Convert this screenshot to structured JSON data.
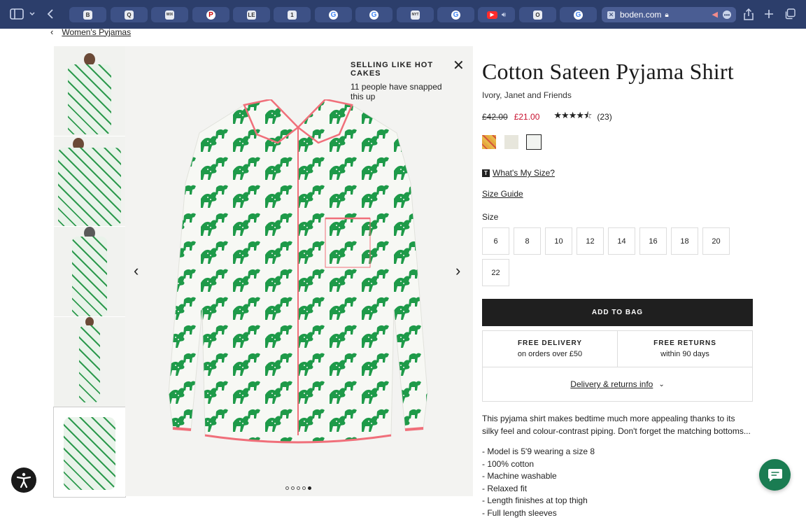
{
  "browser": {
    "tabs": [
      {
        "icon": "b-favicon",
        "glyph": "B"
      },
      {
        "icon": "q-favicon",
        "glyph": "Q"
      },
      {
        "icon": "wix-favicon",
        "glyph": "WIX"
      },
      {
        "icon": "pinterest-favicon",
        "glyph": "P"
      },
      {
        "icon": "le-favicon",
        "glyph": "LE"
      },
      {
        "icon": "one-favicon",
        "glyph": "1"
      },
      {
        "icon": "google-favicon",
        "glyph": "G"
      },
      {
        "icon": "google-favicon",
        "glyph": "G"
      },
      {
        "icon": "nyt-favicon",
        "glyph": "NYT"
      },
      {
        "icon": "google-favicon",
        "glyph": "G"
      },
      {
        "icon": "youtube-favicon",
        "glyph": "▶"
      },
      {
        "icon": "o-favicon",
        "glyph": "O"
      },
      {
        "icon": "google-favicon",
        "glyph": "G"
      }
    ],
    "active_url": "boden.com"
  },
  "breadcrumb": {
    "label": "Women's Pyjamas"
  },
  "gallery": {
    "banner_title": "SELLING LIKE HOT CAKES",
    "banner_text": "11 people have snapped this up",
    "dots_total": 5,
    "dots_active": 5
  },
  "product": {
    "title": "Cotton Sateen Pyjama Shirt",
    "colour": "Ivory, Janet and Friends",
    "old_price": "£42.00",
    "new_price": "£21.00",
    "rating": 4.5,
    "review_count": "(23)",
    "size_help": "What's My Size?",
    "size_guide": "Size Guide",
    "size_label": "Size",
    "sizes": [
      "6",
      "8",
      "10",
      "12",
      "14",
      "16",
      "18",
      "20",
      "22"
    ],
    "add_to_bag": "ADD TO BAG",
    "perks": [
      {
        "title": "FREE DELIVERY",
        "text": "on orders over £50"
      },
      {
        "title": "FREE RETURNS",
        "text": "within 90 days"
      }
    ],
    "delivery_link": "Delivery & returns info",
    "description": "This pyjama shirt makes bedtime much more appealing thanks to its silky feel and colour-contrast piping. Don't forget the matching bottoms...",
    "bullets": [
      "- Model is 5'9 wearing a size 8",
      "- 100% cotton",
      "- Machine washable",
      "- Relaxed fit",
      "- Length finishes at top thigh",
      "- Full length sleeves"
    ]
  },
  "colors": {
    "accent": "#c8102e",
    "chat": "#1a7c52",
    "chrome": "#2c3e6b",
    "print_green": "#1e9a49",
    "piping": "#f06f7a"
  }
}
